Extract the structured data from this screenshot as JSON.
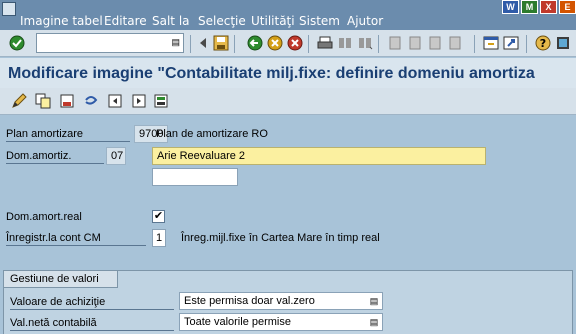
{
  "menubar": {
    "items": [
      "Imagine tabel",
      "Editare",
      "Salt la",
      "Selecţie",
      "Utilităţi",
      "Sistem",
      "Ajutor"
    ]
  },
  "window_buttons": [
    "W",
    "M",
    "X",
    "E"
  ],
  "toolbar": {
    "command_value": "",
    "icons": [
      "enter-icon",
      "history-dropdown-icon",
      "back-arrow-icon",
      "save-icon",
      "back-icon",
      "exit-icon",
      "cancel-icon",
      "print-icon",
      "find-icon",
      "find-next-icon",
      "first-page-icon",
      "previous-page-icon",
      "next-page-icon",
      "last-page-icon",
      "new-session-icon",
      "shortcut-icon",
      "help-icon",
      "customize-icon"
    ]
  },
  "page": {
    "title": "Modificare imagine \"Contabilitate milj.fixe: definire domeniu amortiza"
  },
  "app_toolbar": {
    "icons": [
      "change-icon",
      "copy-icon",
      "delete-icon",
      "undo-icon",
      "previous-entry-icon",
      "next-entry-icon",
      "choose-icon"
    ]
  },
  "form": {
    "plan_label": "Plan amortizare",
    "plan_value": "9700",
    "plan_desc": "Plan de amortizare RO",
    "area_label": "Dom.amortiz.",
    "area_value": "07",
    "area_desc": "Arie Reevaluare 2",
    "short_desc_value": "",
    "real_area_label": "Dom.amort.real",
    "real_area_checked": "✔",
    "post_label": "Înregistr.la cont CM",
    "post_value": "1",
    "post_desc": "Înreg.mijl.fixe în Cartea Mare în timp real"
  },
  "group": {
    "title": "Gestiune de valori",
    "rows": [
      {
        "label": "Valoare de achiziţie",
        "value": "Este permisa doar val.zero"
      },
      {
        "label": "Val.netă contabilă",
        "value": "Toate valorile permise"
      }
    ]
  },
  "colors": {
    "menubar": "#6b8cad",
    "background": "#a8c3d8",
    "title": "#1a3f73",
    "highlight_field": "#fbf0a0"
  }
}
